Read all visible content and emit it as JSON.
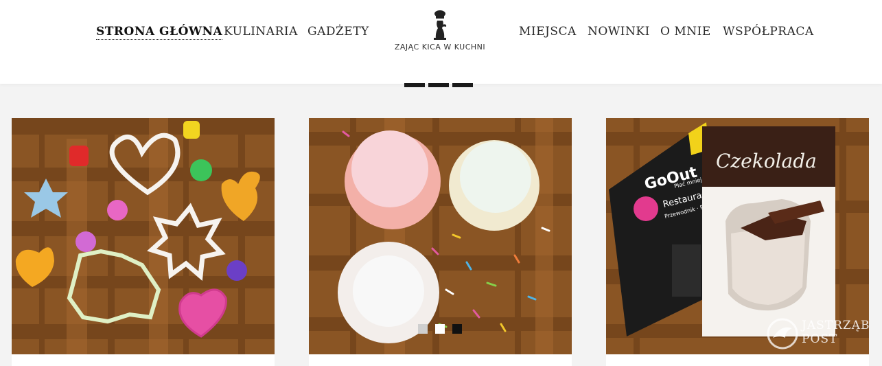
{
  "nav": {
    "left": [
      {
        "label": "STRONA GŁÓWNA",
        "active": true
      },
      {
        "label": "KULINARIA",
        "active": false
      },
      {
        "label": "GADŻETY",
        "active": false
      }
    ],
    "right": [
      {
        "label": "MIEJSCA",
        "active": false
      },
      {
        "label": "NOWINKI",
        "active": false
      },
      {
        "label": "O MNIE",
        "active": false
      },
      {
        "label": "WSPÓŁPRACA",
        "active": false
      }
    ]
  },
  "logo": {
    "text": "ZAJĄC KICA W KUCHNI",
    "icon": "rabbit-chef-icon"
  },
  "posts": [
    {
      "image": "cookie cutters and silicone molds"
    },
    {
      "image": "cupcake liners with sprinkles"
    },
    {
      "image": "chocolate book and GoOut guide",
      "book_title": "Czekolada",
      "guide_title": "GoOut",
      "guide_sub": "Płać mniej",
      "guide_label": "Restauracje",
      "guide_sub2": "Przewodnik · Rabat"
    }
  ],
  "watermark": {
    "line1": "JASTRZĄB",
    "line2": "POST"
  },
  "colors": {
    "nav_text": "#2b2b2b",
    "background": "#f3f3f3",
    "wood": "#8a5524"
  }
}
